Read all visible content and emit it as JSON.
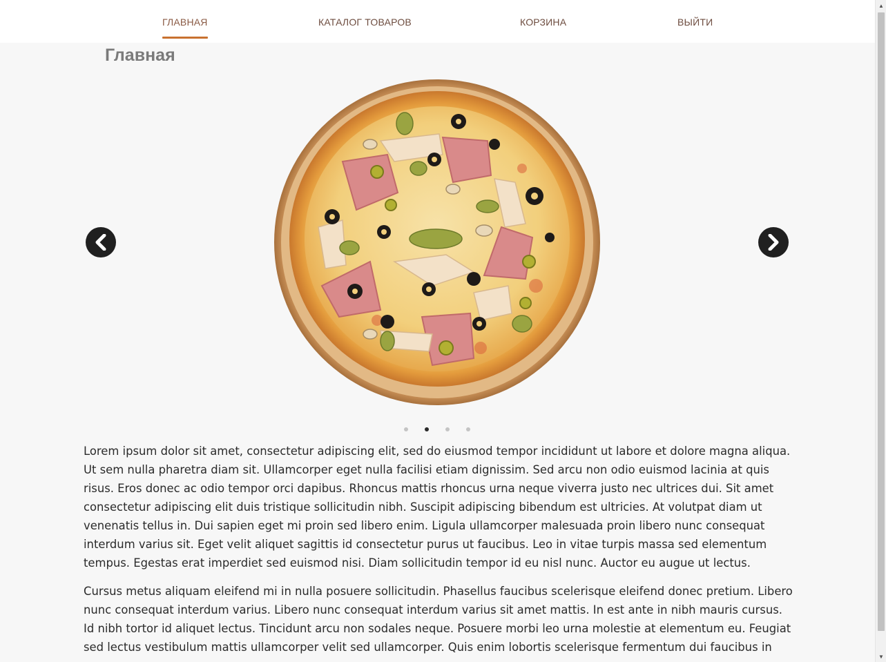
{
  "nav": {
    "items": [
      {
        "label": "ГЛАВНАЯ",
        "active": true
      },
      {
        "label": "КАТАЛОГ ТОВАРОВ",
        "active": false
      },
      {
        "label": "КОРЗИНА",
        "active": false
      },
      {
        "label": "ВЫЙТИ",
        "active": false
      }
    ],
    "accent_color": "#c8712f"
  },
  "page": {
    "title": "Главная"
  },
  "carousel": {
    "slide_image": "pizza-image",
    "prev_icon": "chevron-left-icon",
    "next_icon": "chevron-right-icon",
    "slide_count": 4,
    "active_index": 1
  },
  "article": {
    "paragraphs": [
      "Lorem ipsum dolor sit amet, consectetur adipiscing elit, sed do eiusmod tempor incididunt ut labore et dolore magna aliqua. Ut sem nulla pharetra diam sit. Ullamcorper eget nulla facilisi etiam dignissim. Sed arcu non odio euismod lacinia at quis risus. Eros donec ac odio tempor orci dapibus. Rhoncus mattis rhoncus urna neque viverra justo nec ultrices dui. Sit amet consectetur adipiscing elit duis tristique sollicitudin nibh. Suscipit adipiscing bibendum est ultricies. At volutpat diam ut venenatis tellus in. Dui sapien eget mi proin sed libero enim. Ligula ullamcorper malesuada proin libero nunc consequat interdum varius sit. Eget velit aliquet sagittis id consectetur purus ut faucibus. Leo in vitae turpis massa sed elementum tempus. Egestas erat imperdiet sed euismod nisi. Diam sollicitudin tempor id eu nisl nunc. Auctor eu augue ut lectus.",
      "Cursus metus aliquam eleifend mi in nulla posuere sollicitudin. Phasellus faucibus scelerisque eleifend donec pretium. Libero nunc consequat interdum varius. Libero nunc consequat interdum varius sit amet mattis. In est ante in nibh mauris cursus. Id nibh tortor id aliquet lectus. Tincidunt arcu non sodales neque. Posuere morbi leo urna molestie at elementum eu. Feugiat sed lectus vestibulum mattis ullamcorper velit sed ullamcorper. Quis enim lobortis scelerisque fermentum dui faucibus in ornare"
    ]
  }
}
